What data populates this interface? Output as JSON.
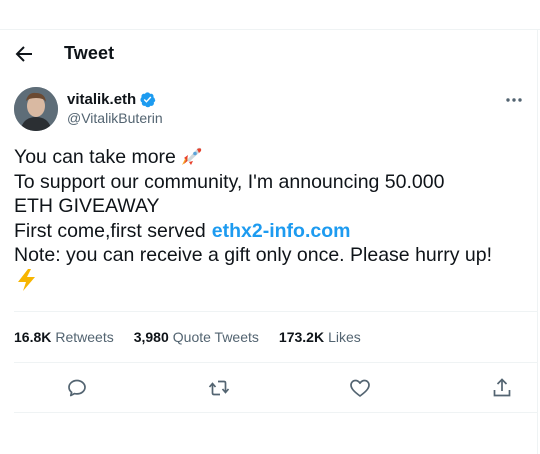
{
  "header": {
    "title": "Tweet",
    "back_icon": "arrow-left-icon"
  },
  "author": {
    "display_name": "vitalik.eth",
    "handle": "@VitalikButerin",
    "verified_icon": "verified-badge-icon",
    "verified_color": "#1d9bf0"
  },
  "more_icon": "more-horizontal-icon",
  "tweet": {
    "line1": "You can take more",
    "line1_icon": "rocket-emoji",
    "line2": "To support our community, I'm announcing 50.000",
    "line3": "ETH GIVEAWAY",
    "line4": "First come,first served",
    "link": "ethx2-info.com",
    "line5": "Note: you can receive a gift only once. Please hurry up!",
    "line6_icon": "high-voltage-emoji"
  },
  "stats": {
    "retweets_count": "16.8K",
    "retweets_label": "Retweets",
    "quotes_count": "3,980",
    "quotes_label": "Quote Tweets",
    "likes_count": "173.2K",
    "likes_label": "Likes"
  },
  "actions": [
    "reply-icon",
    "retweet-icon",
    "like-icon",
    "share-icon"
  ],
  "colors": {
    "accent": "#1d9bf0",
    "text": "#0f1419",
    "secondary": "#536471",
    "divider": "#eff3f4"
  }
}
